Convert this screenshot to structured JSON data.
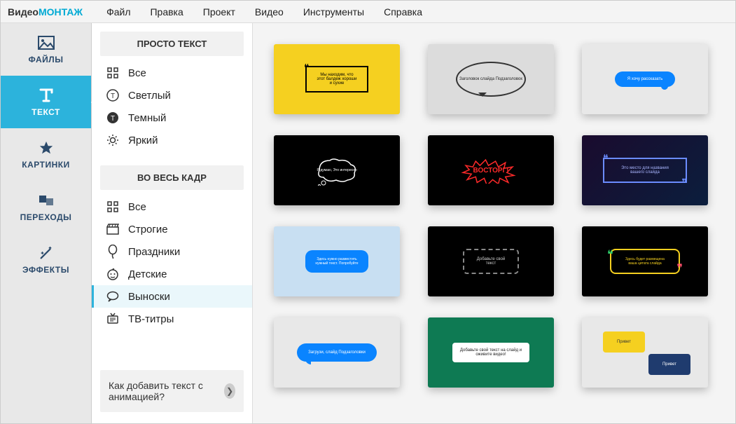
{
  "logo": {
    "part1": "Видео",
    "part2": "МОНТАЖ"
  },
  "menus": [
    "Файл",
    "Правка",
    "Проект",
    "Видео",
    "Инструменты",
    "Справка"
  ],
  "rail": [
    {
      "id": "files",
      "label": "ФАЙЛЫ"
    },
    {
      "id": "text",
      "label": "ТЕКСТ",
      "active": true
    },
    {
      "id": "pictures",
      "label": "КАРТИНКИ"
    },
    {
      "id": "transitions",
      "label": "ПЕРЕХОДЫ"
    },
    {
      "id": "effects",
      "label": "ЭФФЕКТЫ"
    }
  ],
  "groups": [
    {
      "title": "ПРОСТО ТЕКСТ",
      "items": [
        {
          "id": "all1",
          "label": "Все",
          "icon": "grid"
        },
        {
          "id": "light",
          "label": "Светлый",
          "icon": "circle-t"
        },
        {
          "id": "dark",
          "label": "Темный",
          "icon": "circle-t-fill"
        },
        {
          "id": "bright",
          "label": "Яркий",
          "icon": "sun"
        }
      ]
    },
    {
      "title": "ВО ВЕСЬ КАДР",
      "items": [
        {
          "id": "all2",
          "label": "Все",
          "icon": "grid"
        },
        {
          "id": "strict",
          "label": "Строгие",
          "icon": "clapper"
        },
        {
          "id": "holidays",
          "label": "Праздники",
          "icon": "balloon"
        },
        {
          "id": "kids",
          "label": "Детские",
          "icon": "baby"
        },
        {
          "id": "callouts",
          "label": "Выноски",
          "icon": "speech",
          "active": true
        },
        {
          "id": "tvtitles",
          "label": "ТВ-титры",
          "icon": "tv"
        }
      ]
    }
  ],
  "help": {
    "text": "Как добавить текст с анимацией?"
  },
  "thumbs": [
    {
      "id": "t1",
      "text": "Мы находим, что этот балдеж хороши и сухие"
    },
    {
      "id": "t2",
      "text": "Заголовок слайда Подзаголовок"
    },
    {
      "id": "t3",
      "text": "Я хочу рассказать"
    },
    {
      "id": "t4",
      "text": "Я думаю, Это интересно"
    },
    {
      "id": "t5",
      "text": "ВОСТОРГ!"
    },
    {
      "id": "t6",
      "text": "Это место для названия вашего слайда"
    },
    {
      "id": "t7",
      "text": "Здесь нужно разместить нужный текст. Попробуйте"
    },
    {
      "id": "t8",
      "text": "Добавьте свой текст"
    },
    {
      "id": "t9",
      "text": "Здесь будет размещена ваша цитата слайда"
    },
    {
      "id": "t10",
      "text": "Загрузи, слайд Подзаголовки"
    },
    {
      "id": "t11",
      "text": "Добавьте свой текст на слайд и оживите видео!"
    },
    {
      "id": "t12",
      "text1": "Привет",
      "text2": "Привет"
    }
  ]
}
